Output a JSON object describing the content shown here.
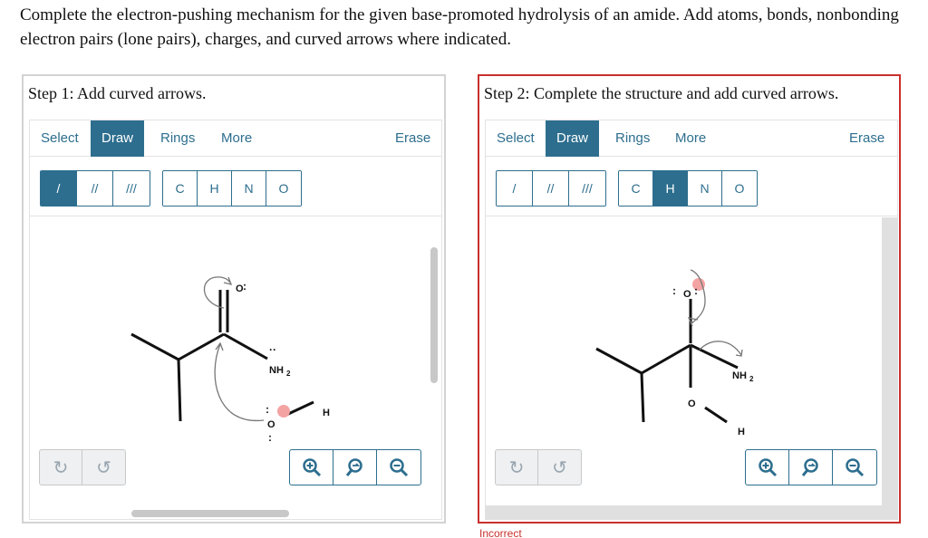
{
  "question": "Complete the electron-pushing mechanism for the given base-promoted hydrolysis of an amide. Add atoms, bonds, nonbonding electron pairs (lone pairs), charges, and curved arrows where indicated.",
  "colors": {
    "accent": "#2d6e8e",
    "error": "#c9302c",
    "lone_pair_charge": "#f4a3a3"
  },
  "panels": [
    {
      "step_label": "Step 1: Add curved arrows.",
      "toolbar": {
        "select": "Select",
        "draw": "Draw",
        "rings": "Rings",
        "more": "More",
        "erase": "Erase",
        "active_tab": "Draw"
      },
      "bonds": [
        "/",
        "//",
        "///"
      ],
      "active_bond": "/",
      "atoms": [
        "C",
        "H",
        "N",
        "O"
      ],
      "active_atom": "",
      "undo_icon": "undo-icon",
      "redo_icon": "redo-icon",
      "zoom_icons": [
        "zoom-in-icon",
        "zoom-reset-icon",
        "zoom-out-icon"
      ],
      "molecule": {
        "o_label": "O",
        "nh2_label": "NH",
        "nh2_sub": "2",
        "hydroxide_o": "O",
        "hydroxide_h": "H",
        "lp": ":",
        "lp_h": "··"
      }
    },
    {
      "step_label": "Step 2: Complete the structure and add curved arrows.",
      "toolbar": {
        "select": "Select",
        "draw": "Draw",
        "rings": "Rings",
        "more": "More",
        "erase": "Erase",
        "active_tab": "Draw"
      },
      "bonds": [
        "/",
        "//",
        "///"
      ],
      "active_bond": "",
      "atoms": [
        "C",
        "H",
        "N",
        "O"
      ],
      "active_atom": "H",
      "undo_icon": "undo-icon",
      "redo_icon": "redo-icon",
      "zoom_icons": [
        "zoom-in-icon",
        "zoom-reset-icon",
        "zoom-out-icon"
      ],
      "molecule": {
        "o_label": "O",
        "nh2_label": "NH",
        "nh2_sub": "2",
        "hydroxide_o": "O",
        "hydroxide_h": "H",
        "lp": ":",
        "lp_h": "··"
      }
    }
  ],
  "status": "Incorrect"
}
